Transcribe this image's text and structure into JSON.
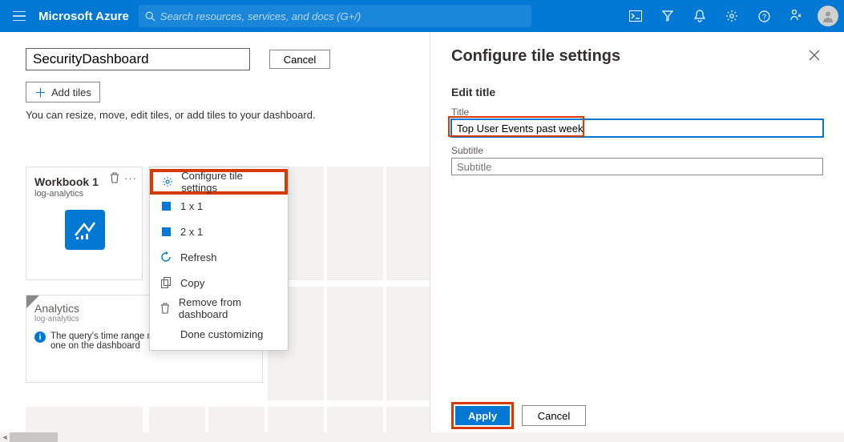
{
  "topbar": {
    "brand": "Microsoft Azure",
    "search_placeholder": "Search resources, services, and docs (G+/)"
  },
  "dashboard": {
    "name_value": "SecurityDashboard",
    "cancel_label": "Cancel",
    "add_tiles_label": "Add tiles",
    "help_text": "You can resize, move, edit tiles, or add tiles to your dashboard."
  },
  "tile1": {
    "title": "Workbook 1",
    "subtitle": "log-analytics"
  },
  "tile2": {
    "title": "Analytics",
    "subtitle": "log-analytics",
    "info": "The query's time range may be different from the one on the dashboard"
  },
  "ctx": {
    "configure": "Configure tile settings",
    "s1": "1 x 1",
    "s2": "2 x 1",
    "refresh": "Refresh",
    "copy": "Copy",
    "remove": "Remove from dashboard",
    "done": "Done customizing"
  },
  "panel": {
    "title": "Configure tile settings",
    "section": "Edit title",
    "title_label": "Title",
    "title_value": "Top User Events past week",
    "subtitle_label": "Subtitle",
    "subtitle_placeholder": "Subtitle",
    "apply": "Apply",
    "cancel": "Cancel"
  }
}
